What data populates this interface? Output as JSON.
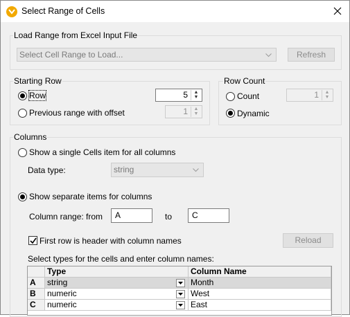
{
  "window": {
    "title": "Select Range of Cells"
  },
  "load_group": {
    "legend": "Load Range from Excel Input File",
    "range_combo": "Select Cell Range to Load...",
    "refresh_button": "Refresh"
  },
  "starting_row": {
    "legend": "Starting Row",
    "row_option": "Row",
    "row_value": "5",
    "previous_option": "Previous range with offset",
    "offset_value": "1"
  },
  "row_count": {
    "legend": "Row Count",
    "count_option": "Count",
    "count_value": "1",
    "dynamic_option": "Dynamic"
  },
  "columns": {
    "legend": "Columns",
    "single_option": "Show a single Cells item for all columns",
    "data_type_label": "Data type:",
    "data_type_value": "string",
    "separate_option": "Show separate items for columns",
    "range_label": "Column range: from",
    "range_from": "A",
    "to_label": "to",
    "range_to": "C",
    "header_check": "First row is header with column names",
    "reload_button": "Reload",
    "types_label": "Select types for the cells and enter column names:"
  },
  "grid": {
    "headers": [
      "Type",
      "Column Name"
    ],
    "rows": [
      {
        "letter": "A",
        "type": "string",
        "name": "Month"
      },
      {
        "letter": "B",
        "type": "numeric",
        "name": "West"
      },
      {
        "letter": "C",
        "type": "numeric",
        "name": "East"
      }
    ]
  },
  "colors": {
    "accent": "#f2a900",
    "selected_row": "#d9d9d9"
  }
}
